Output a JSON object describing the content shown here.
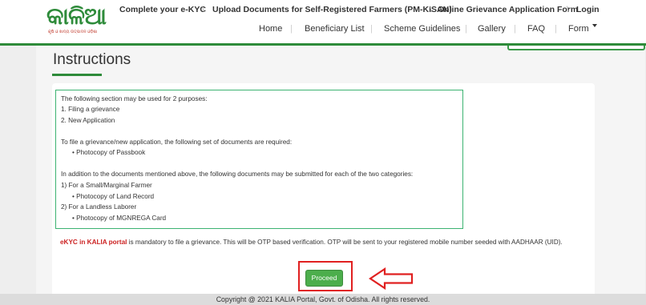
{
  "logo": {
    "script": "କାଳିଆ",
    "tagline": "କୃଷି ଓ ଖାଦ୍ୟ ଉତ୍ପାଦନ ଓଡ଼ିଶା"
  },
  "toplinks": [
    "Complete your e-KYC",
    "Upload Documents for Self-Registered Farmers (PM-KISAN)",
    "Online Grievance Application Form",
    "Login"
  ],
  "nav": [
    "Home",
    "Beneficiary List",
    "Scheme Guidelines",
    "Gallery",
    "FAQ",
    "Form"
  ],
  "page_title": "Instructions",
  "instructions": {
    "l1": "The following section may be used for 2 purposes:",
    "l2": "1. Filing a grievance",
    "l3": "2. New Application",
    "l4": "To file a grievance/new application, the following set of documents are required:",
    "l5": "Photocopy of Passbook",
    "l6": "In addition to the documents mentioned above, the following documents may be submitted for each of the two categories:",
    "l7": "1) For a Small/Marginal Farmer",
    "l8": "Photocopy of Land Record",
    "l9": "2) For a Landless Laborer",
    "l10": "Photocopy of MGNREGA Card"
  },
  "note": {
    "highlight": "eKYC in KALIA portal",
    "text": " is mandatory to file a grievance. This will be OTP based verification. OTP will be sent to your registered mobile number seeded with AADHAAR (UID)."
  },
  "proceed_label": "Proceed",
  "footer": "Copyright @ 2021 KALIA Portal, Govt. of Odisha. All rights reserved.",
  "colors": {
    "brand_green": "#2e8b3a",
    "button_green": "#4cae4c",
    "highlight_red": "#e02020"
  }
}
